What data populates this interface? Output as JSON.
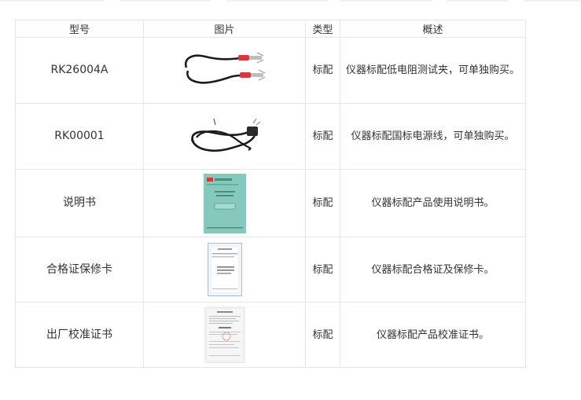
{
  "table": {
    "headers": {
      "model": "型号",
      "image": "图片",
      "type": "类型",
      "description": "概述"
    },
    "rows": [
      {
        "model": "RK26004A",
        "image_icon": "test-lead-clips-icon",
        "type": "标配",
        "description": "仪器标配低电阻测试夹，可单独购买。"
      },
      {
        "model": "RK00001",
        "image_icon": "power-cord-icon",
        "type": "标配",
        "description": "仪器标配国标电源线，可单独购买。"
      },
      {
        "model": "说明书",
        "image_icon": "manual-booklet-icon",
        "type": "标配",
        "description": "仪器标配产品使用说明书。"
      },
      {
        "model": "合格证保修卡",
        "image_icon": "warranty-card-icon",
        "type": "标配",
        "description": "仪器标配合格证及保修卡。"
      },
      {
        "model": "出厂校准证书",
        "image_icon": "calibration-certificate-icon",
        "type": "标配",
        "description": "仪器标配产品校准证书。"
      }
    ]
  },
  "colors": {
    "border": "#e6e6e6",
    "text": "#333333",
    "manual_cover": "#84c9bc",
    "card_frame": "#a9c2e8",
    "clip_red": "#d9383a"
  }
}
